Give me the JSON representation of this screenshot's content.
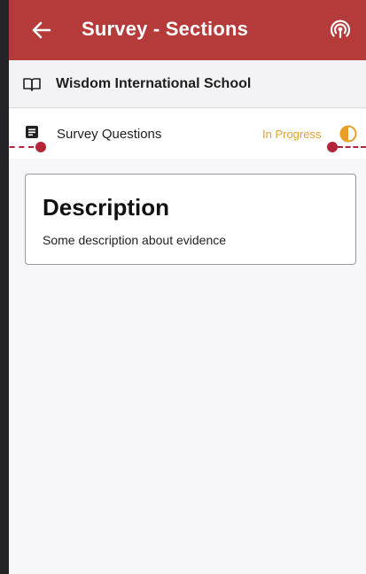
{
  "app_bar": {
    "title": "Survey - Sections",
    "back_icon": "arrow-left-icon",
    "action_icon": "podcast-icon",
    "color": "#b53a3a"
  },
  "school": {
    "icon": "book-open-icon",
    "name": "Wisdom International School"
  },
  "section": {
    "icon": "document-icon",
    "label": "Survey Questions",
    "status": "In Progress",
    "status_icon": "half-circle-icon",
    "status_color": "#e8a02a"
  },
  "description": {
    "title": "Description",
    "body": "Some description about evidence"
  }
}
